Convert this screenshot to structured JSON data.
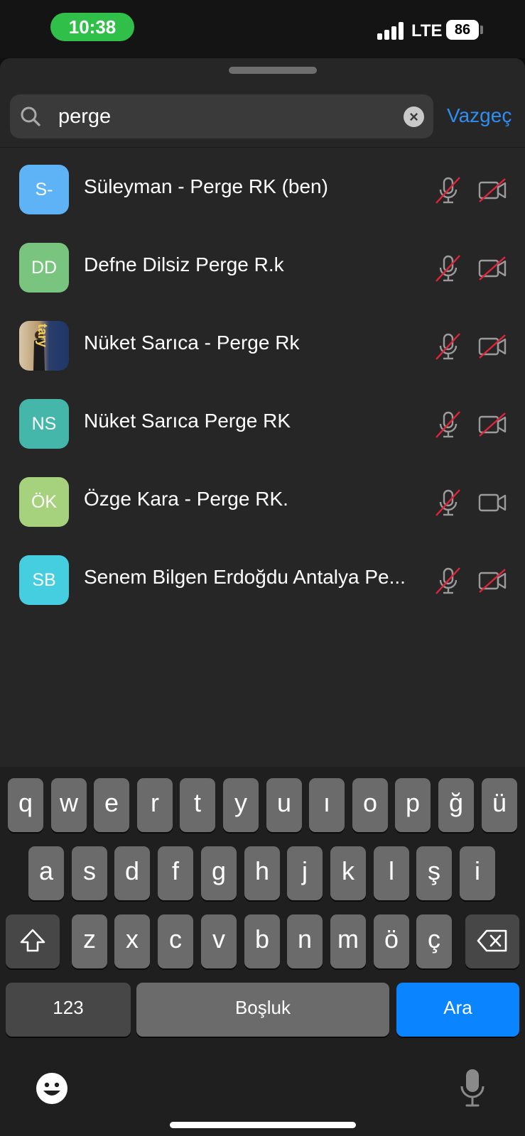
{
  "status_bar": {
    "time": "10:38",
    "network": "LTE",
    "battery": "86"
  },
  "search": {
    "value": "perge",
    "placeholder": "",
    "cancel_label": "Vazgeç"
  },
  "participants": [
    {
      "initials": "S-",
      "avatar_color": "#5eb3f7",
      "name": "Süleyman - Perge RK (ben)",
      "mic": "muted",
      "video": "off"
    },
    {
      "initials": "DD",
      "avatar_color": "#79c47e",
      "name": "Defne Dilsiz Perge R.k",
      "mic": "muted",
      "video": "off"
    },
    {
      "initials": "",
      "avatar_color": "photo",
      "avatar_text": "tary",
      "name": "Nüket Sarıca - Perge Rk",
      "mic": "muted",
      "video": "off"
    },
    {
      "initials": "NS",
      "avatar_color": "#44b6aa",
      "name": "Nüket Sarıca Perge RK",
      "mic": "muted",
      "video": "off"
    },
    {
      "initials": "ÖK",
      "avatar_color": "#a7d27d",
      "name": "Özge Kara - Perge RK.",
      "mic": "muted",
      "video": "on"
    },
    {
      "initials": "SB",
      "avatar_color": "#45cde0",
      "name": "Senem Bilgen Erdoğdu Antalya Pe...",
      "mic": "muted",
      "video": "off"
    }
  ],
  "keyboard": {
    "row1": [
      "q",
      "w",
      "e",
      "r",
      "t",
      "y",
      "u",
      "ı",
      "o",
      "p",
      "ğ",
      "ü"
    ],
    "row2": [
      "a",
      "s",
      "d",
      "f",
      "g",
      "h",
      "j",
      "k",
      "l",
      "ş",
      "i"
    ],
    "row3": [
      "z",
      "x",
      "c",
      "v",
      "b",
      "n",
      "m",
      "ö",
      "ç"
    ],
    "numbers_label": "123",
    "space_label": "Boşluk",
    "return_label": "Ara"
  },
  "colors": {
    "accent": "#2e8ef2",
    "muted_slash": "#e0253a",
    "return_key": "#0a84ff"
  }
}
